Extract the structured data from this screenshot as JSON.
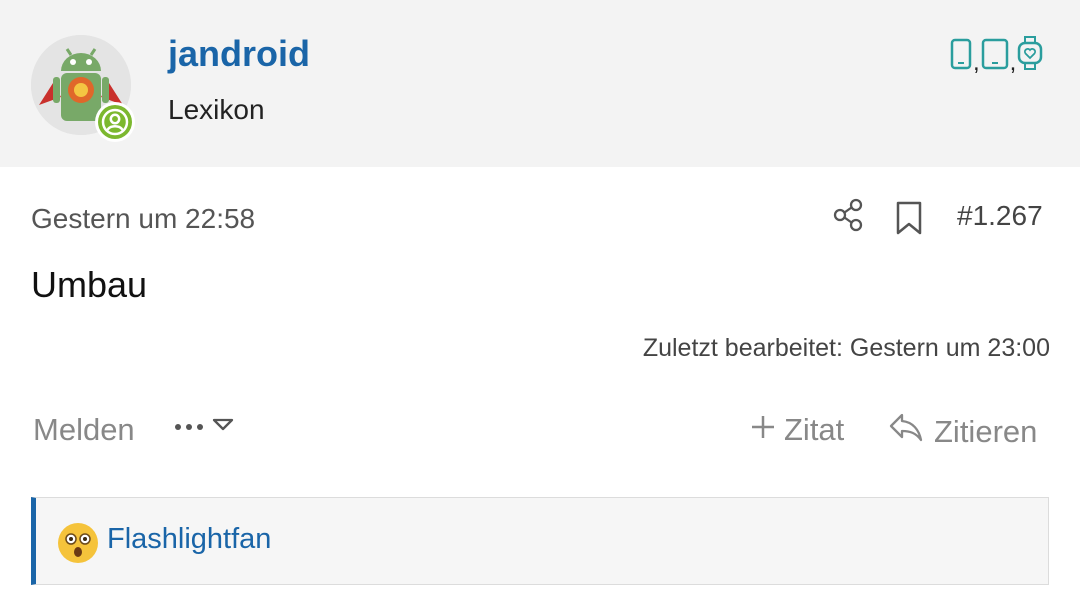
{
  "author": {
    "username": "jandroid",
    "user_title": "Lexikon",
    "avatar_icon": "android-avatar",
    "status_icon": "online-user-icon",
    "devices": [
      {
        "icon": "smartphone-icon"
      },
      {
        "icon": "tablet-icon"
      },
      {
        "icon": "smartwatch-icon"
      }
    ],
    "device_separator": ","
  },
  "post": {
    "timestamp": "Gestern um 22:58",
    "number": "#1.267",
    "body": "Umbau",
    "edited": "Zuletzt bearbeitet: Gestern um 23:00"
  },
  "actions": {
    "report": "Melden",
    "more": "•••",
    "quote_add": "Zitat",
    "quote": "Zitieren"
  },
  "reactions": {
    "emoji_icon": "astonished-face-emoji",
    "user": "Flashlightfan"
  },
  "colors": {
    "link": "#1a65a8",
    "device_icon": "#2a9d9d",
    "online_badge": "#7cb82f",
    "header_bg": "#f3f3f3"
  }
}
